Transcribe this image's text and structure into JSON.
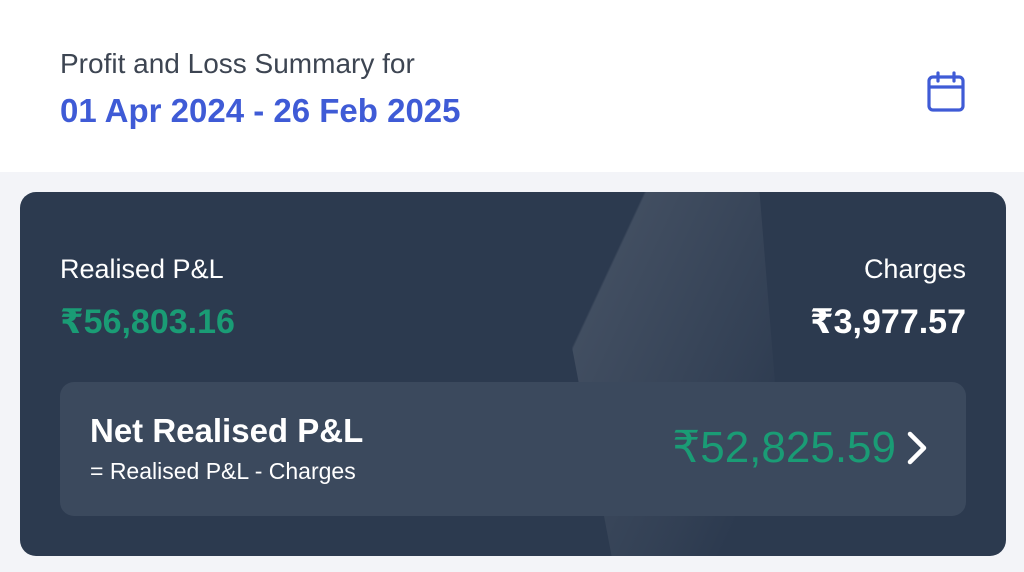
{
  "header": {
    "subtitle": "Profit and Loss Summary for",
    "date_range": "01 Apr 2024 - 26 Feb 2025",
    "calendar_icon": "calendar-icon"
  },
  "summary": {
    "realised_label": "Realised P&L",
    "realised_value": "₹56,803.16",
    "charges_label": "Charges",
    "charges_value": "₹3,977.57",
    "net": {
      "title": "Net Realised P&L",
      "formula": "= Realised P&L - Charges",
      "value": "₹52,825.59",
      "chevron_icon": "chevron-right-icon"
    }
  },
  "colors": {
    "accent": "#3f5bd6",
    "profit": "#1a9c75",
    "card_bg": "#2c3a4f",
    "net_box_bg": "#3b495d"
  }
}
